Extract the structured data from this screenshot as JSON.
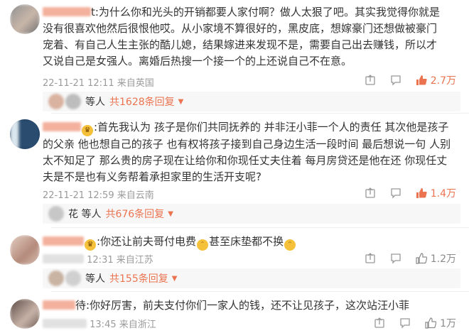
{
  "comments": [
    {
      "text": "t:为什么你和光头的开销都要人家付啊？做人太狠了吧。其实我觉得你就是没有很喜欢他然后很恨他哎。从小家境不算很好的，黑皮底，想嫁豪门还想做被豪门宠着、有自己人生主张的酷儿媳，结果嫁进来发现不是，需要自己出去赚钱，所以才又说自己是女强人。离婚后热搜一个接一个的上还说自己不在意。",
      "meta": "22-11-21 12:11 来自英国",
      "likes": "2.7万",
      "replies_prefix": "等人",
      "replies_count": "共1628条回复"
    },
    {
      "text": ":首先我认为 孩子是你们共同抚养的 并非汪小菲一个人的责任 其次他是孩子的父亲 他也想自己的孩子 也有权将孩子接到自己身边生活一段时间 最后想说一句 人别太不知足了 那么贵的房子现在让给你和你现任丈夫住着 每月房贷还是他在还 你现任丈夫是不是也有义务帮着承担家里的生活开支呢?",
      "meta": "22-11-21 12:59 来自云南",
      "likes": "1.4万",
      "replies_prefix": "花 等人",
      "replies_count": "共676条回复"
    },
    {
      "text_a": ":你还让前夫哥付电费",
      "text_b": "甚至床垫都不换",
      "meta": "12:31 来自江苏",
      "likes": "1.2万",
      "replies_prefix": "等人",
      "replies_count": "共155条回复"
    },
    {
      "text": "待:你好厉害，前夫支付你们一家人的钱，还不让见孩子，这次站汪小菲",
      "meta": "13:45 来自浙江",
      "likes": "1万"
    }
  ],
  "colors": {
    "accent": "#eb7350",
    "meta": "#9a9a9a"
  },
  "icons": {
    "share": "share-icon",
    "comment": "comment-icon",
    "like": "thumb-up-icon"
  }
}
